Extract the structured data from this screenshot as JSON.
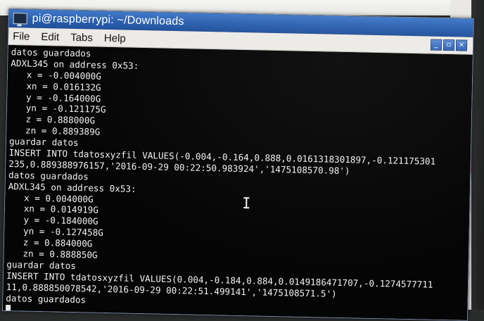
{
  "window": {
    "title": "pi@raspberrypi: ~/Downloads",
    "menu": [
      "File",
      "Edit",
      "Tabs",
      "Help"
    ],
    "controls": {
      "minimize": "_",
      "maximize": "▫",
      "close": "×"
    }
  },
  "terminal": {
    "lines": [
      "datos guardados",
      "ADXL345 on address 0x53:",
      "   x = -0.004000G",
      "   xn = 0.016132G",
      "   y = -0.164000G",
      "   yn = -0.121175G",
      "   z = 0.888000G",
      "   zn = 0.889389G",
      "guardar datos",
      "INSERT INTO tdatosxyzfil VALUES(-0.004,-0.164,0.888,0.0161318301897,-0.121175301",
      "235,0.889388976157,'2016-09-29 00:22:50.983924','1475108570.98')",
      "datos guardados",
      "ADXL345 on address 0x53:",
      "   x = 0.004000G",
      "   xn = 0.014919G",
      "   y = -0.184000G",
      "   yn = -0.127458G",
      "   z = 0.884000G",
      "   zn = 0.888850G",
      "guardar datos",
      "INSERT INTO tdatosxyzfil VALUES(0.004,-0.184,0.884,0.0149186471707,-0.1274577711",
      "11,0.888850078542,'2016-09-29 00:22:51.499141','1475108571.5')",
      "datos guardados"
    ]
  }
}
